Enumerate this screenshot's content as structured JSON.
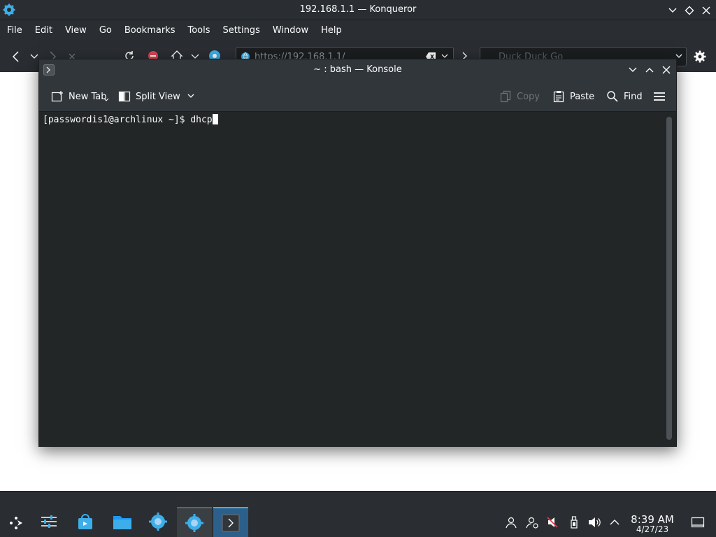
{
  "konqueror": {
    "title": "192.168.1.1 — Konqueror",
    "menu": [
      "File",
      "Edit",
      "View",
      "Go",
      "Bookmarks",
      "Tools",
      "Settings",
      "Window",
      "Help"
    ],
    "url": "https://192.168.1.1/",
    "search_placeholder": "Duck Duck Go"
  },
  "konsole": {
    "title": "~ : bash — Konsole",
    "toolbar": {
      "new_tab": "New Tab",
      "split_view": "Split View",
      "copy": "Copy",
      "paste": "Paste",
      "find": "Find"
    },
    "terminal": {
      "prompt": "[passwordis1@archlinux ~]$ ",
      "input": "dhcp"
    }
  },
  "taskbar": {
    "time": "8:39 AM",
    "date": "4/27/23"
  }
}
